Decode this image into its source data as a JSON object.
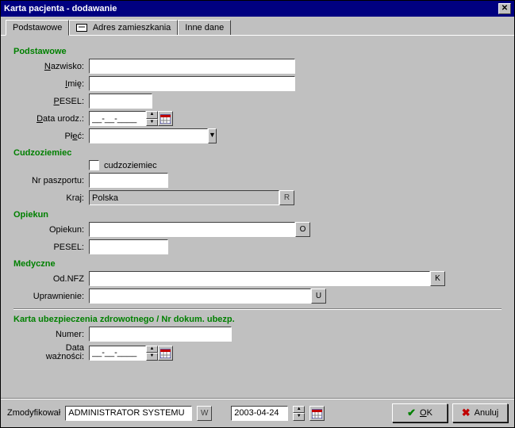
{
  "window": {
    "title": "Karta pacjenta - dodawanie"
  },
  "tabs": {
    "basic": "Podstawowe",
    "address": "Adres zamieszkania",
    "other": "Inne dane"
  },
  "basic": {
    "section": "Podstawowe",
    "surname_label": "Nazwisko:",
    "surname_value": "",
    "name_label": "Imię:",
    "name_value": "",
    "pesel_label": "PESEL:",
    "pesel_value": "",
    "dob_label": "Data urodz.:",
    "dob_value": "__-__-____",
    "sex_label": "Płeć:",
    "sex_value": ""
  },
  "foreigner": {
    "section": "Cudzoziemiec",
    "checkbox_label": "cudzoziemiec",
    "checked": false,
    "passport_label": "Nr paszportu:",
    "passport_value": "",
    "country_label": "Kraj:",
    "country_value": "Polska",
    "country_btn": "R"
  },
  "guardian": {
    "section": "Opiekun",
    "guardian_label": "Opiekun:",
    "guardian_value": "",
    "guardian_btn": "O",
    "pesel_label": "PESEL:",
    "pesel_value": ""
  },
  "medical": {
    "section": "Medyczne",
    "nfz_label": "Od.NFZ",
    "nfz_value": "",
    "nfz_btn": "K",
    "ent_label": "Uprawnienie:",
    "ent_value": "",
    "ent_btn": "U"
  },
  "insurance": {
    "section": "Karta ubezpieczenia zdrowotnego / Nr dokum. ubezp.",
    "number_label": "Numer:",
    "number_value": "",
    "validity_label": "Data ważności:",
    "validity_value": "__-__-____"
  },
  "footer": {
    "modified_label": "Zmodyfikował",
    "modified_by": "ADMINISTRATOR SYSTEMU",
    "modified_btn": "W",
    "modified_date": "2003-04-24",
    "ok_label": "OK",
    "cancel_label": "Anuluj"
  }
}
